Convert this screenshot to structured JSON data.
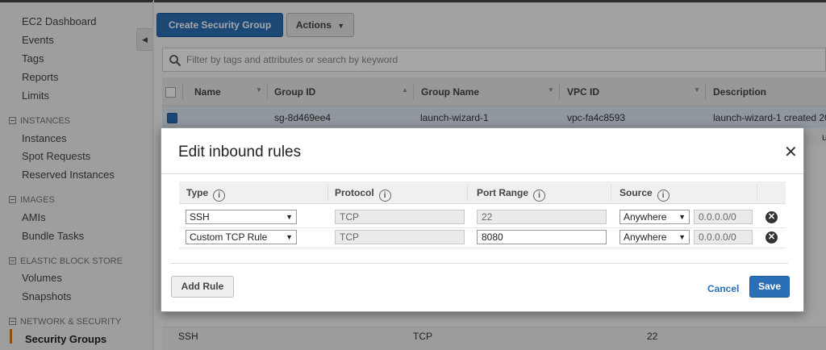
{
  "sidebar": {
    "top_links": [
      "EC2 Dashboard",
      "Events",
      "Tags",
      "Reports",
      "Limits"
    ],
    "sections": [
      {
        "title": "INSTANCES",
        "items": [
          "Instances",
          "Spot Requests",
          "Reserved Instances"
        ]
      },
      {
        "title": "IMAGES",
        "items": [
          "AMIs",
          "Bundle Tasks"
        ]
      },
      {
        "title": "ELASTIC BLOCK STORE",
        "items": [
          "Volumes",
          "Snapshots"
        ]
      },
      {
        "title": "NETWORK & SECURITY",
        "items": [
          "Security Groups"
        ]
      }
    ],
    "collapse_icon": "chevron-left-icon"
  },
  "toolbar": {
    "create_label": "Create Security Group",
    "actions_label": "Actions",
    "actions_icon": "chevron-down-icon"
  },
  "search": {
    "placeholder": "Filter by tags and attributes or search by keyword",
    "icon": "search-icon"
  },
  "table": {
    "columns": [
      "Name",
      "Group ID",
      "Group Name",
      "VPC ID",
      "Description"
    ],
    "rows": [
      {
        "name": "",
        "group_id": "sg-8d469ee4",
        "group_name": "launch-wizard-1",
        "vpc_id": "vpc-fa4c8593",
        "description": "launch-wizard-1 created 20"
      }
    ],
    "row2_peek": "up"
  },
  "bottom_rule": {
    "type": "SSH",
    "protocol": "TCP",
    "port": "22"
  },
  "modal": {
    "title": "Edit inbound rules",
    "close_icon": "close-icon",
    "columns": [
      "Type",
      "Protocol",
      "Port Range",
      "Source"
    ],
    "info_glyph": "i",
    "rules": [
      {
        "type": "SSH",
        "protocol": "TCP",
        "port": "22",
        "source": "Anywhere",
        "cidr": "0.0.0.0/0"
      },
      {
        "type": "Custom TCP Rule",
        "protocol": "TCP",
        "port": "8080",
        "source": "Anywhere",
        "cidr": "0.0.0.0/0"
      }
    ],
    "add_rule_label": "Add Rule",
    "cancel_label": "Cancel",
    "save_label": "Save"
  },
  "colors": {
    "accent": "#2b6fb6",
    "active_marker": "#e47911"
  }
}
